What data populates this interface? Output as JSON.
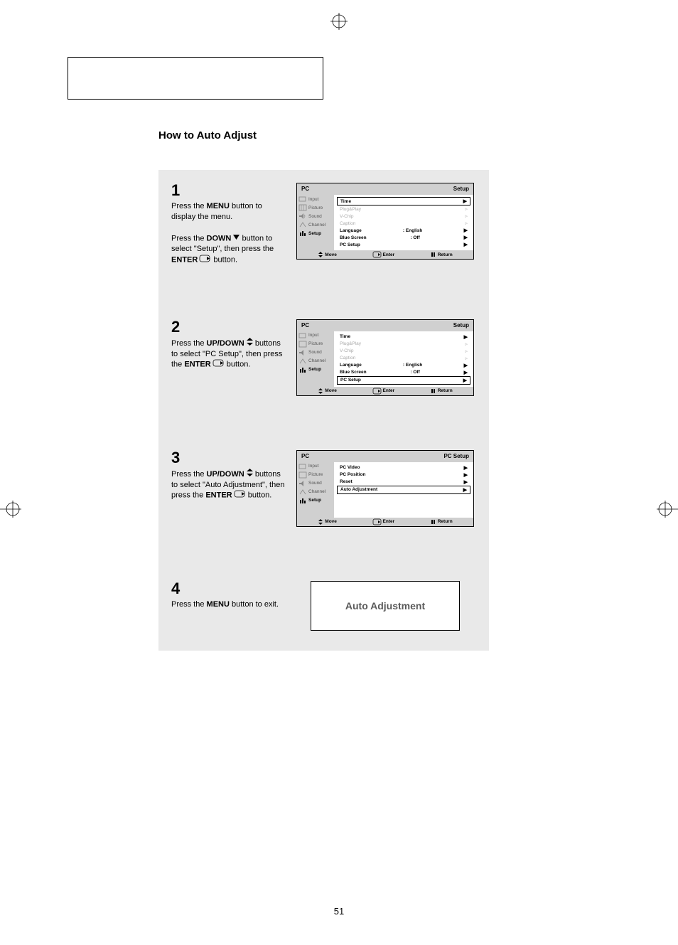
{
  "page_number": "51",
  "section_title": "How to Auto Adjust",
  "steps": [
    {
      "num": "1",
      "p1_a": "Press the ",
      "p1_b": "MENU",
      "p1_c": " button to display the menu.",
      "p2_a": "Press the ",
      "p2_b": "DOWN",
      "p2_c": " button to select \"Setup\", then press the ",
      "p2_d": "ENTER",
      "p2_e": "  button."
    },
    {
      "num": "2",
      "p1_a": "Press the ",
      "p1_b": "UP/DOWN",
      "p1_c": " buttons to select \"PC  Setup\", then press the ",
      "p1_d": "ENTER",
      "p1_e": "  button."
    },
    {
      "num": "3",
      "p1_a": "Press the ",
      "p1_b": "UP/DOWN",
      "p1_c": " buttons to select \"Auto Adjustment\", then press the ",
      "p1_d": "ENTER",
      "p1_e": " button."
    },
    {
      "num": "4",
      "p1_a": "Press the ",
      "p1_b": "MENU",
      "p1_c": " button to exit."
    }
  ],
  "osd_common": {
    "title_left": "PC",
    "footer_move": "Move",
    "footer_enter": "Enter",
    "footer_return": "Return",
    "side": [
      {
        "icon": "input-icon",
        "label": "Input"
      },
      {
        "icon": "picture-icon",
        "label": "Picture"
      },
      {
        "icon": "sound-icon",
        "label": "Sound"
      },
      {
        "icon": "channel-icon",
        "label": "Channel"
      },
      {
        "icon": "setup-icon",
        "label": "Setup"
      }
    ]
  },
  "osd1": {
    "title_right": "Setup",
    "rows": [
      {
        "label": "Time",
        "val": "",
        "boxed": true,
        "active": true
      },
      {
        "label": "Plug&Play",
        "val": "",
        "dim": true
      },
      {
        "label": "V-Chip",
        "val": "",
        "dim": true
      },
      {
        "label": "Caption",
        "val": "",
        "dim": true
      },
      {
        "label": "Language",
        "val": ":   English",
        "active": true
      },
      {
        "label": "Blue Screen",
        "val": ":   Off",
        "active": true
      },
      {
        "label": "PC Setup",
        "val": "",
        "active": true
      }
    ]
  },
  "osd2": {
    "title_right": "Setup",
    "rows": [
      {
        "label": "Time",
        "val": "",
        "active": true
      },
      {
        "label": "Plug&Play",
        "val": "",
        "dim": true
      },
      {
        "label": "V-Chip",
        "val": "",
        "dim": true
      },
      {
        "label": "Caption",
        "val": "",
        "dim": true
      },
      {
        "label": "Language",
        "val": ":   English",
        "active": true
      },
      {
        "label": "Blue Screen",
        "val": ":   Off",
        "active": true
      },
      {
        "label": "PC Setup",
        "val": "",
        "boxed": true,
        "active": true
      }
    ]
  },
  "osd3": {
    "title_right": "PC Setup",
    "rows": [
      {
        "label": "PC Video",
        "val": "",
        "active": true
      },
      {
        "label": "PC Position",
        "val": "",
        "active": true
      },
      {
        "label": "Reset",
        "val": "",
        "active": true
      },
      {
        "label": "Auto Adjustment",
        "val": "",
        "boxed": true,
        "active": true
      }
    ]
  },
  "auto_adjust_label": "Auto  Adjustment"
}
